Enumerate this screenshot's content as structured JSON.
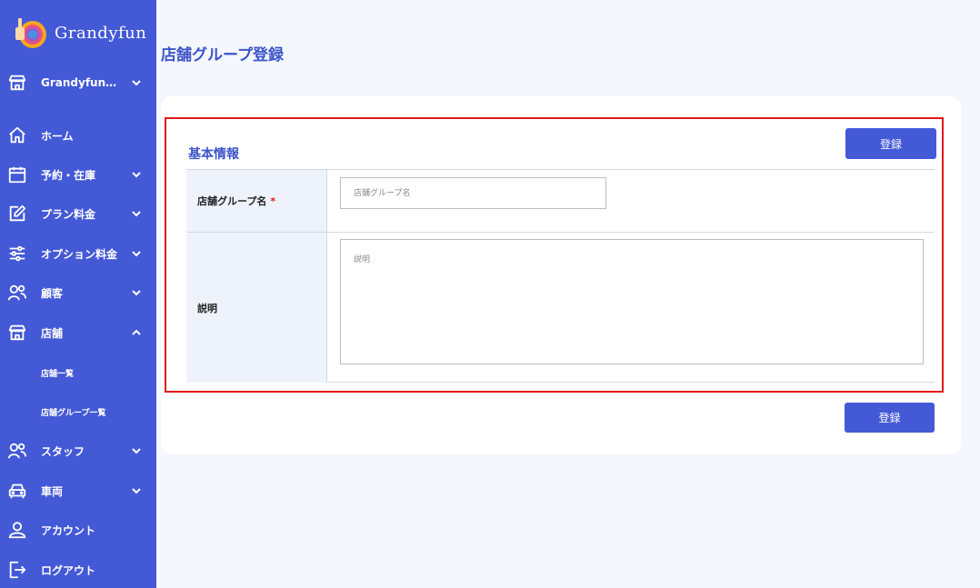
{
  "brand": {
    "name": "Grandyfun"
  },
  "sidebar": {
    "store_selector": "Grandyfun…",
    "items": [
      {
        "label": "ホーム",
        "icon": "home-icon"
      },
      {
        "label": "予約・在庫",
        "icon": "calendar-icon"
      },
      {
        "label": "プラン料金",
        "icon": "edit-icon"
      },
      {
        "label": "オプション料金",
        "icon": "sliders-icon"
      },
      {
        "label": "顧客",
        "icon": "users-icon"
      },
      {
        "label": "店舗",
        "icon": "store-icon"
      },
      {
        "label": "スタッフ",
        "icon": "users-icon"
      },
      {
        "label": "車両",
        "icon": "car-icon"
      },
      {
        "label": "アカウント",
        "icon": "user-icon"
      },
      {
        "label": "ログアウト",
        "icon": "logout-icon"
      }
    ],
    "store_sub": [
      {
        "label": "店舗一覧"
      },
      {
        "label": "店舗グループ一覧"
      }
    ]
  },
  "page": {
    "title": "店舗グループ登録",
    "section_title": "基本情報",
    "register_label": "登録",
    "fields": {
      "group_name": {
        "label": "店舗グループ名",
        "required_mark": "*",
        "placeholder": "店舗グループ名",
        "value": ""
      },
      "description": {
        "label": "説明",
        "placeholder": "説明",
        "value": ""
      }
    }
  },
  "colors": {
    "sidebar": "#4359d6",
    "accent": "#3d55c9",
    "background": "#f4f7fd",
    "highlight_border": "#e01818",
    "label_bg": "#eef3fb"
  }
}
